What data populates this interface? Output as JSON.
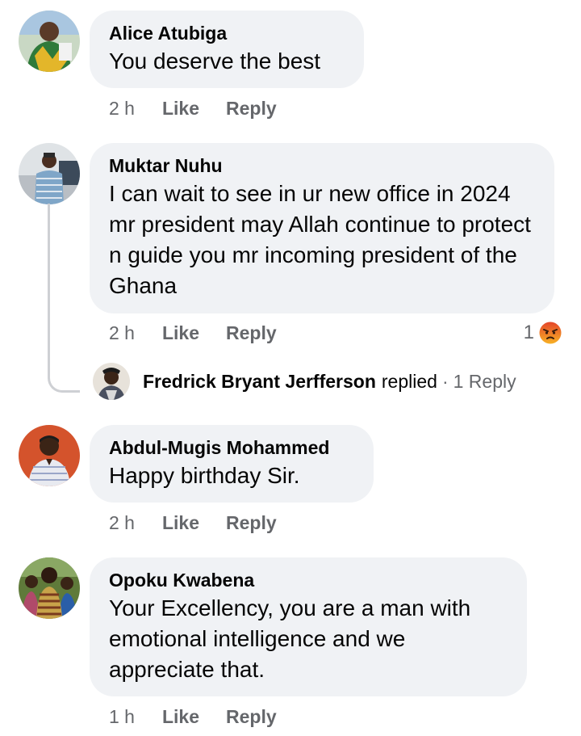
{
  "comments": [
    {
      "author": "Alice Atubiga",
      "text": "You deserve the best",
      "time": "2 h",
      "like": "Like",
      "reply": "Reply"
    },
    {
      "author": "Muktar Nuhu",
      "text": "I can wait to see in ur new office in 2024 mr president may Allah continue to protect n guide you mr incoming president of the Ghana",
      "time": "2 h",
      "like": "Like",
      "reply": "Reply",
      "reaction_count": "1",
      "reaction_icon": "angry-reaction-icon",
      "replies": {
        "name": "Fredrick Bryant Jerfferson",
        "verb": "replied",
        "separator": "·",
        "count": "1 Reply"
      }
    },
    {
      "author": "Abdul-Mugis Mohammed",
      "text": "Happy birthday Sir.",
      "time": "2 h",
      "like": "Like",
      "reply": "Reply"
    },
    {
      "author": "Opoku Kwabena",
      "text": "Your Excellency, you are a man with emotional intelligence and we appreciate that.",
      "time": "1 h",
      "like": "Like",
      "reply": "Reply"
    }
  ],
  "colors": {
    "bubble": "#f0f2f5",
    "secondary_text": "#65676b",
    "primary_text": "#050505",
    "thread_line": "#ced0d4",
    "angry_reaction": "#e9710f"
  }
}
